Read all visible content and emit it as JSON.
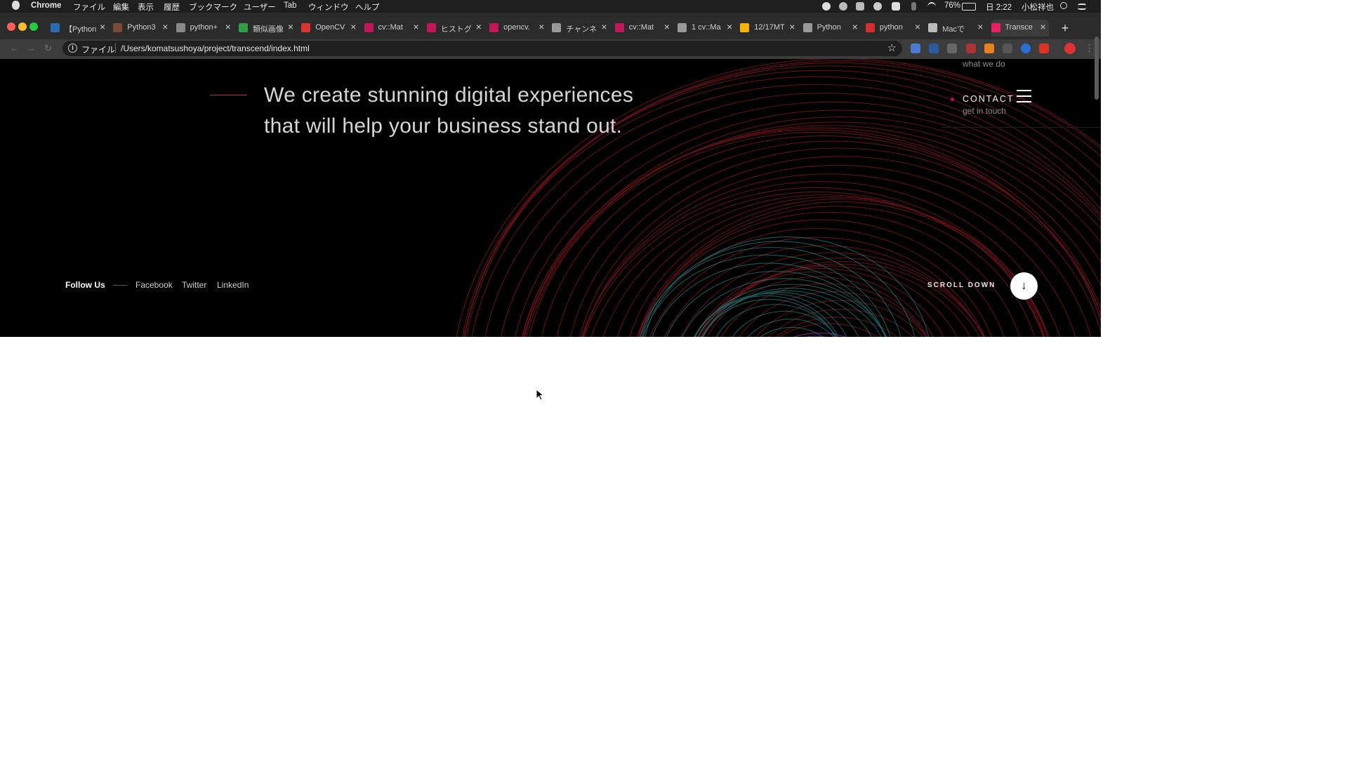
{
  "menubar": {
    "app": "Chrome",
    "items": [
      "ファイル",
      "編集",
      "表示",
      "履歴",
      "ブックマーク",
      "ユーザー",
      "Tab",
      "ウィンドウ",
      "ヘルプ"
    ],
    "battery": "76%",
    "clock": "日 2:22",
    "user": "小松祥也"
  },
  "tabs": [
    {
      "title": "【Python",
      "fav": "cg-favicon",
      "color": "#2b6cb0"
    },
    {
      "title": "Python3",
      "fav": "avatar-favicon",
      "color": "#7a4a32"
    },
    {
      "title": "python+",
      "fav": "info-favicon",
      "color": "#888888"
    },
    {
      "title": "類似画像",
      "fav": "green-favicon",
      "color": "#2f9e44"
    },
    {
      "title": "OpenCV",
      "fav": "opencv-favicon",
      "color": "#d33"
    },
    {
      "title": "cv::Mat",
      "fav": "qiita-favicon",
      "color": "#c2185b"
    },
    {
      "title": "ヒストグ",
      "fav": "qiita-favicon",
      "color": "#c2185b"
    },
    {
      "title": "opencv.",
      "fav": "qiita-favicon",
      "color": "#c2185b"
    },
    {
      "title": "チャンネ",
      "fav": "bird-favicon",
      "color": "#999999"
    },
    {
      "title": "cv::Mat",
      "fav": "qiita-favicon",
      "color": "#c2185b"
    },
    {
      "title": "1 cv::Ma",
      "fav": "globe-favicon",
      "color": "#999999"
    },
    {
      "title": "12/17MT",
      "fav": "slides-favicon",
      "color": "#f4b400"
    },
    {
      "title": "Python",
      "fav": "globe-favicon",
      "color": "#999999"
    },
    {
      "title": "python",
      "fav": "red-favicon",
      "color": "#d32f2f"
    },
    {
      "title": "Macで",
      "fav": "apple-favicon",
      "color": "#bbbbbb"
    },
    {
      "title": "Transce",
      "fav": "t-favicon",
      "color": "#e91e63"
    }
  ],
  "address": {
    "scheme": "ファイル",
    "url": "/Users/komatsushoya/project/transcend/index.html"
  },
  "hero": {
    "headline_line1": "We create stunning digital experiences",
    "headline_line2": "that will help your business stand out.",
    "nav_prev_sub": "what we do",
    "nav_label": "CONTACT",
    "nav_sub": "get in touch",
    "follow_label": "Follow Us",
    "social": [
      "Facebook",
      "Twitter",
      "LinkedIn"
    ],
    "scroll_label": "SCROLL DOWN",
    "scroll_arrow": "↓"
  },
  "colors": {
    "hero_bg": "#000000",
    "accent_red": "#c0262c",
    "accent_pink": "#d8005a",
    "ring_red": "#b3202a",
    "ring_teal": "#1f8a8a",
    "ring_purple": "#8b2fa8"
  }
}
